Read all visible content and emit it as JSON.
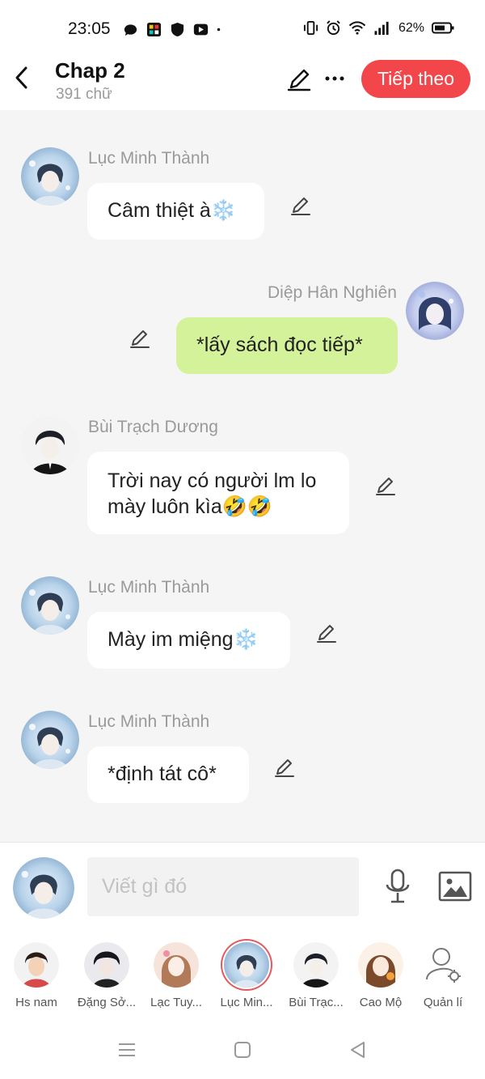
{
  "status_bar": {
    "time": "23:05",
    "battery": "62%",
    "left_icons": [
      "bubble-icon",
      "app-grid-icon",
      "shield-icon",
      "play-icon",
      "dot-icon"
    ],
    "right_icons": [
      "vibrate-icon",
      "alarm-icon",
      "wifi-icon",
      "signal-icon",
      "battery-icon"
    ]
  },
  "header": {
    "title": "Chap 2",
    "subtitle": "391 chữ",
    "next_label": "Tiếp theo",
    "accent": "#f2464b"
  },
  "messages": [
    {
      "sender": "Lục Minh Thành",
      "text": "Câm thiệt à❄️",
      "side": "left",
      "avatar": "snow-boy"
    },
    {
      "sender": "Diệp Hân Nghiên",
      "text": "*lấy sách đọc tiếp*",
      "side": "right",
      "avatar": "snow-girl"
    },
    {
      "sender": "Bùi Trạch Dương",
      "text": "Trời nay có người lm lo",
      "text2": "mày luôn kìa🤣🤣",
      "side": "left",
      "avatar": "dark-boy"
    },
    {
      "sender": "Lục Minh Thành",
      "text": "Mày im miệng❄️",
      "side": "left",
      "avatar": "snow-boy"
    },
    {
      "sender": "Lục Minh Thành",
      "text": "*định tát cô*",
      "side": "left",
      "avatar": "snow-boy"
    }
  ],
  "composer": {
    "placeholder": "Viết gì đó"
  },
  "characters": [
    {
      "label": "Hs nam"
    },
    {
      "label": "Đặng Sở..."
    },
    {
      "label": "Lạc Tuy..."
    },
    {
      "label": "Lục Min...",
      "selected": true
    },
    {
      "label": "Bùi Trạc..."
    },
    {
      "label": "Cao Mộ"
    },
    {
      "label": "Quản lí"
    }
  ],
  "colors": {
    "bubble_right": "#d4f29a",
    "bubble_left": "#ffffff",
    "background": "#f5f5f5"
  }
}
